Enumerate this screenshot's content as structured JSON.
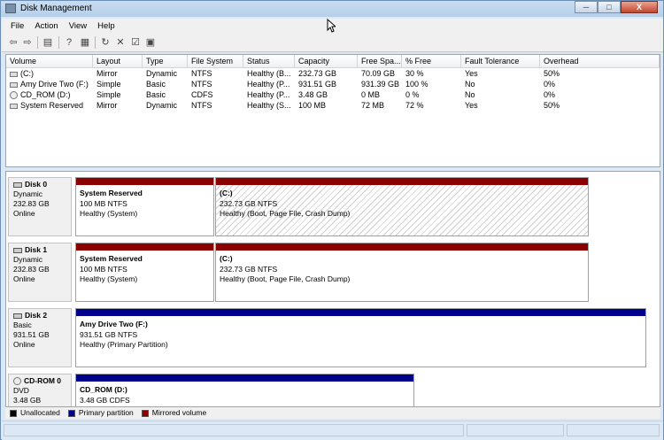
{
  "window": {
    "title": "Disk Management",
    "buttons": {
      "minimize": "─",
      "maximize": "□",
      "close": "X"
    }
  },
  "menu": [
    "File",
    "Action",
    "View",
    "Help"
  ],
  "toolbar": [
    {
      "icon": "back-arrow-icon",
      "glyph": "⇦"
    },
    {
      "icon": "forward-arrow-icon",
      "glyph": "⇨"
    },
    {
      "icon": "console-tree-icon",
      "glyph": "▤"
    },
    {
      "icon": "help-icon",
      "glyph": "?"
    },
    {
      "icon": "properties-icon",
      "glyph": "▦"
    },
    {
      "icon": "refresh-icon",
      "glyph": "↻"
    },
    {
      "icon": "delete-icon",
      "glyph": "✕"
    },
    {
      "icon": "check-icon",
      "glyph": "☑"
    },
    {
      "icon": "settings-icon",
      "glyph": "▣"
    }
  ],
  "volume_list": {
    "columns": [
      "Volume",
      "Layout",
      "Type",
      "File System",
      "Status",
      "Capacity",
      "Free Spa...",
      "% Free",
      "Fault Tolerance",
      "Overhead"
    ],
    "rows": [
      {
        "icon": "drive-icon",
        "cells": [
          "(C:)",
          "Mirror",
          "Dynamic",
          "NTFS",
          "Healthy (B...",
          "232.73 GB",
          "70.09 GB",
          "30 %",
          "Yes",
          "50%"
        ]
      },
      {
        "icon": "drive-icon",
        "cells": [
          "Amy Drive Two (F:)",
          "Simple",
          "Basic",
          "NTFS",
          "Healthy (P...",
          "931.51 GB",
          "931.39 GB",
          "100 %",
          "No",
          "0%"
        ]
      },
      {
        "icon": "cd-icon",
        "cells": [
          "CD_ROM (D:)",
          "Simple",
          "Basic",
          "CDFS",
          "Healthy (P...",
          "3.48 GB",
          "0 MB",
          "0 %",
          "No",
          "0%"
        ]
      },
      {
        "icon": "drive-icon",
        "cells": [
          "System Reserved",
          "Mirror",
          "Dynamic",
          "NTFS",
          "Healthy (S...",
          "100 MB",
          "72 MB",
          "72 %",
          "Yes",
          "50%"
        ]
      }
    ]
  },
  "disks": [
    {
      "name": "Disk 0",
      "type": "Dynamic",
      "size": "232.83 GB",
      "state": "Online",
      "partitions": [
        {
          "name": "System Reserved",
          "size": "100 MB NTFS",
          "status": "Healthy (System)",
          "kind": "mirrored",
          "selected": false
        },
        {
          "name": "(C:)",
          "size": "232.73 GB NTFS",
          "status": "Healthy (Boot, Page File, Crash Dump)",
          "kind": "mirrored",
          "selected": true
        }
      ]
    },
    {
      "name": "Disk 1",
      "type": "Dynamic",
      "size": "232.83 GB",
      "state": "Online",
      "partitions": [
        {
          "name": "System Reserved",
          "size": "100 MB NTFS",
          "status": "Healthy (System)",
          "kind": "mirrored",
          "selected": false
        },
        {
          "name": "(C:)",
          "size": "232.73 GB NTFS",
          "status": "Healthy (Boot, Page File, Crash Dump)",
          "kind": "mirrored",
          "selected": false
        }
      ]
    },
    {
      "name": "Disk 2",
      "type": "Basic",
      "size": "931.51 GB",
      "state": "Online",
      "partitions": [
        {
          "name": "Amy Drive Two  (F:)",
          "size": "931.51 GB NTFS",
          "status": "Healthy (Primary Partition)",
          "kind": "primary",
          "selected": false
        }
      ]
    },
    {
      "name": "CD-ROM 0",
      "type": "DVD",
      "size": "3.48 GB",
      "state": "",
      "partitions": [
        {
          "name": "CD_ROM  (D:)",
          "size": "3.48 GB CDFS",
          "status": "",
          "kind": "primary",
          "selected": false
        }
      ]
    }
  ],
  "legend": [
    {
      "label": "Unallocated",
      "color": "#000000"
    },
    {
      "label": "Primary partition",
      "color": "#00008b"
    },
    {
      "label": "Mirrored volume",
      "color": "#8b0000"
    }
  ],
  "colors": {
    "mirrored": "#8b0000",
    "primary": "#00008b",
    "unallocated": "#000000"
  }
}
